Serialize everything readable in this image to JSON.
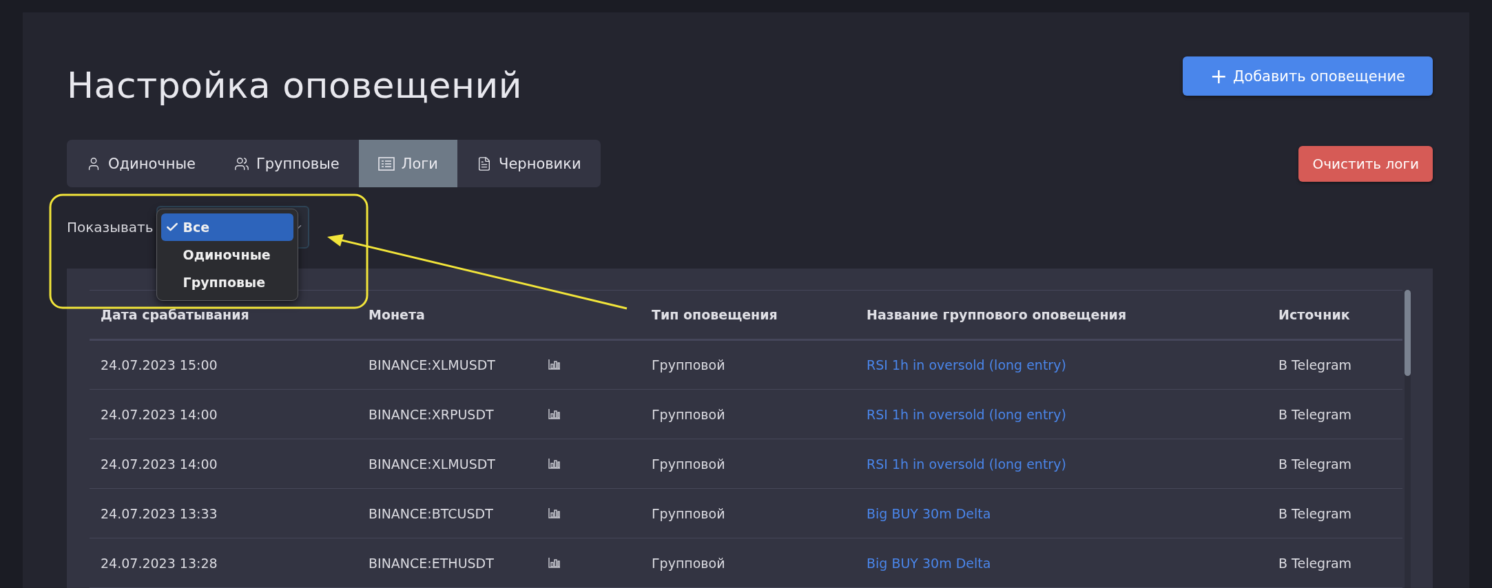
{
  "title": "Настройка оповещений",
  "add_button": {
    "icon": "+",
    "label": "Добавить оповещение"
  },
  "tabs": [
    {
      "label": "Одиночные",
      "selected": false
    },
    {
      "label": "Групповые",
      "selected": false
    },
    {
      "label": "Логи",
      "selected": true
    },
    {
      "label": "Черновики",
      "selected": false
    }
  ],
  "clear_button": "Очистить логи",
  "filter": {
    "label": "Показывать",
    "options": [
      {
        "label": "Все",
        "selected": true
      },
      {
        "label": "Одиночные",
        "selected": false
      },
      {
        "label": "Групповые",
        "selected": false
      }
    ]
  },
  "table": {
    "columns": [
      "Дата срабатывания",
      "Монета",
      "Тип оповещения",
      "Название группового оповещения",
      "Источник"
    ],
    "rows": [
      {
        "date": "24.07.2023 15:00",
        "coin": "BINANCE:XLMUSDT",
        "type": "Групповой",
        "name": "RSI 1h in oversold (long entry)",
        "source": "В Telegram"
      },
      {
        "date": "24.07.2023 14:00",
        "coin": "BINANCE:XRPUSDT",
        "type": "Групповой",
        "name": "RSI 1h in oversold (long entry)",
        "source": "В Telegram"
      },
      {
        "date": "24.07.2023 14:00",
        "coin": "BINANCE:XLMUSDT",
        "type": "Групповой",
        "name": "RSI 1h in oversold (long entry)",
        "source": "В Telegram"
      },
      {
        "date": "24.07.2023 13:33",
        "coin": "BINANCE:BTCUSDT",
        "type": "Групповой",
        "name": "Big BUY 30m Delta",
        "source": "В Telegram"
      },
      {
        "date": "24.07.2023 13:28",
        "coin": "BINANCE:ETHUSDT",
        "type": "Групповой",
        "name": "Big BUY 30m Delta",
        "source": "В Telegram"
      }
    ]
  }
}
